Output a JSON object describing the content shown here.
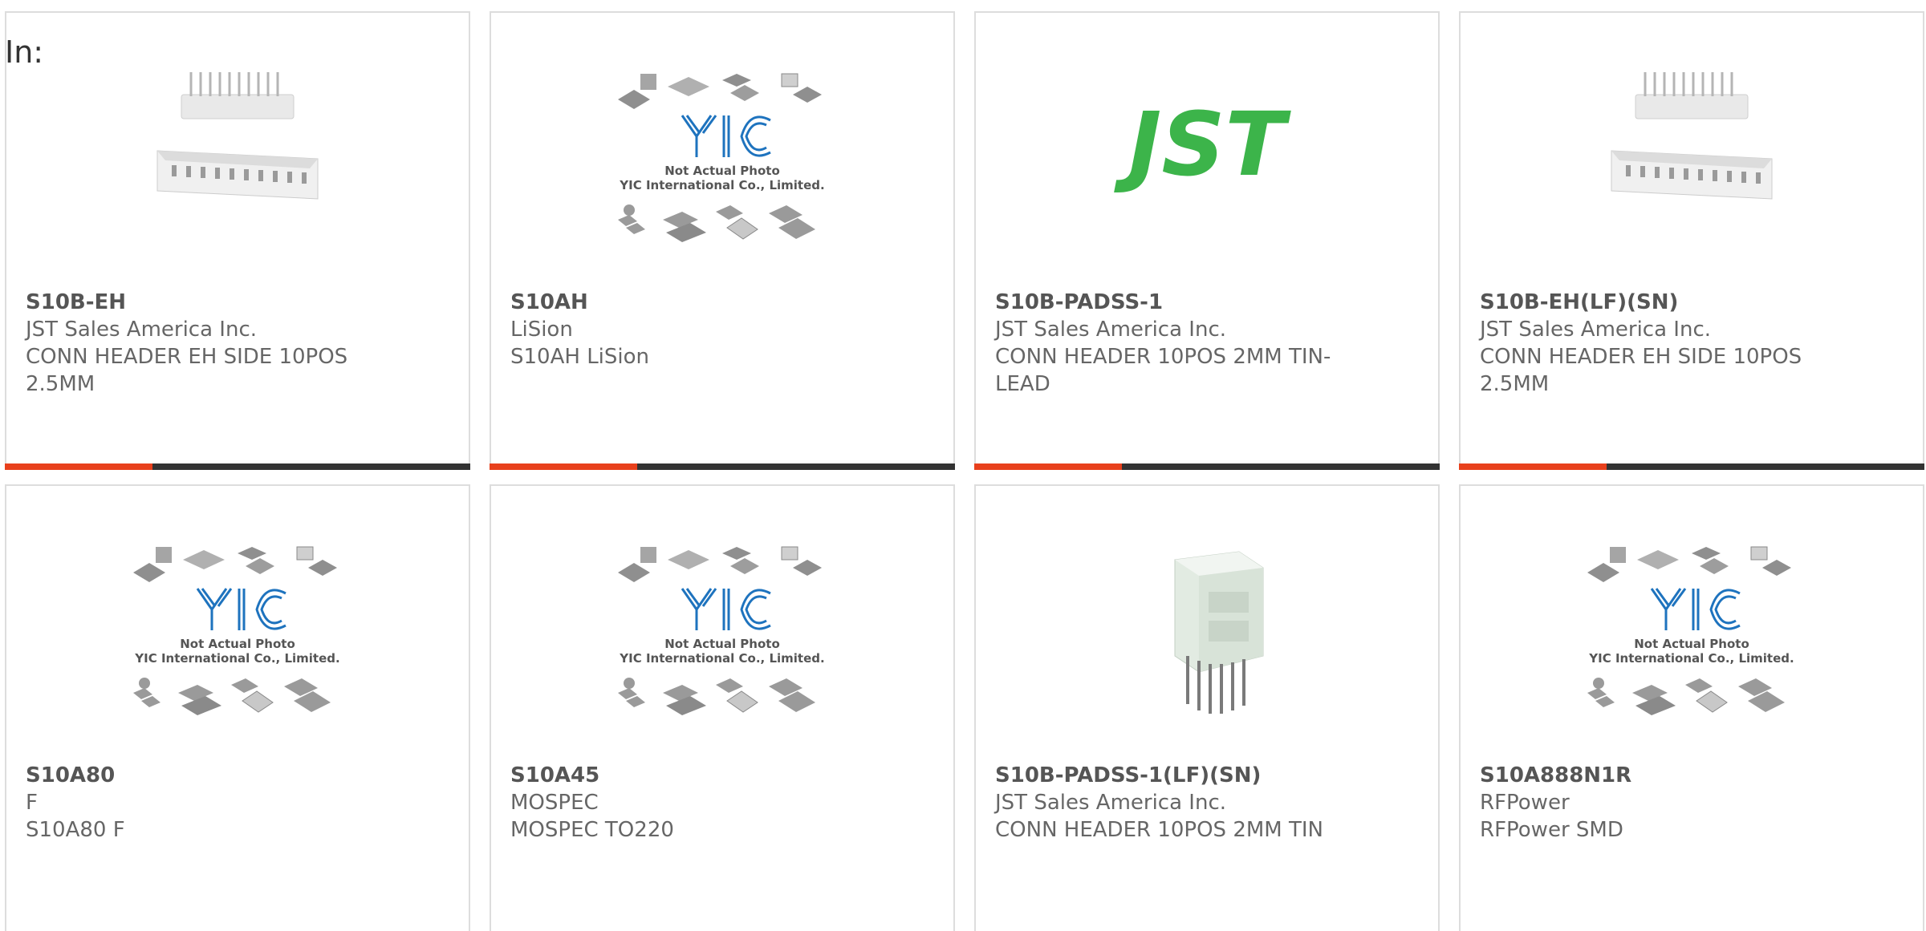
{
  "filter_label": "In:",
  "colors": {
    "accent": "#e8401c",
    "bar": "#333333",
    "jst_green": "#3cb44a",
    "yic_blue": "#1e73be",
    "border": "#dddddd"
  },
  "products": [
    {
      "part_number": "S10B-EH",
      "manufacturer": "JST Sales America Inc.",
      "description": "CONN HEADER EH SIDE 10POS 2.5MM",
      "image": "connector-pair-image"
    },
    {
      "part_number": "S10AH",
      "manufacturer": "LiSion",
      "description": "S10AH LiSion",
      "image": "yic-placeholder-image",
      "placeholder_caption_1": "Not Actual Photo",
      "placeholder_caption_2": "YIC International Co., Limited."
    },
    {
      "part_number": "S10B-PADSS-1",
      "manufacturer": "JST Sales America Inc.",
      "description": "CONN HEADER 10POS 2MM TIN-LEAD",
      "image": "jst-logo-image",
      "logo_text": "JST"
    },
    {
      "part_number": "S10B-EH(LF)(SN)",
      "manufacturer": "JST Sales America Inc.",
      "description": "CONN HEADER EH SIDE 10POS 2.5MM",
      "image": "connector-pair-image"
    },
    {
      "part_number": "S10A80",
      "manufacturer": "F",
      "description": "S10A80 F",
      "image": "yic-placeholder-image",
      "placeholder_caption_1": "Not Actual Photo",
      "placeholder_caption_2": "YIC International Co., Limited."
    },
    {
      "part_number": "S10A45",
      "manufacturer": "MOSPEC",
      "description": "MOSPEC TO220",
      "image": "yic-placeholder-image",
      "placeholder_caption_1": "Not Actual Photo",
      "placeholder_caption_2": "YIC International Co., Limited."
    },
    {
      "part_number": "S10B-PADSS-1(LF)(SN)",
      "manufacturer": "JST Sales America Inc.",
      "description": "CONN HEADER 10POS 2MM TIN",
      "image": "header-connector-image"
    },
    {
      "part_number": "S10A888N1R",
      "manufacturer": "RFPower",
      "description": "RFPower SMD",
      "image": "yic-placeholder-image",
      "placeholder_caption_1": "Not Actual Photo",
      "placeholder_caption_2": "YIC International Co., Limited."
    }
  ]
}
